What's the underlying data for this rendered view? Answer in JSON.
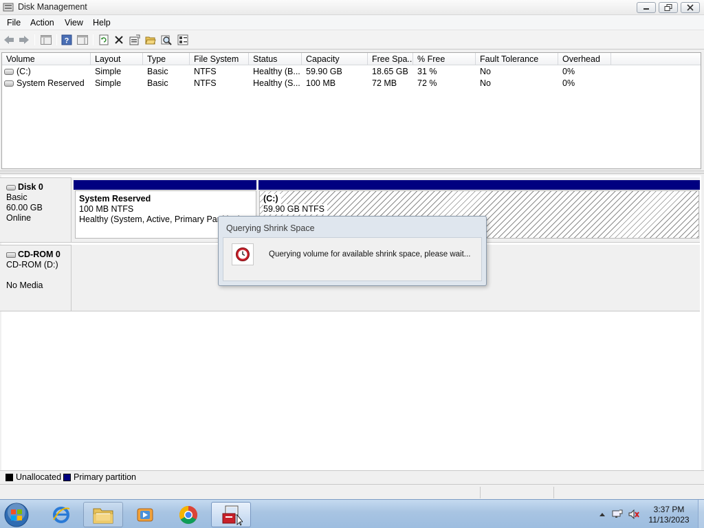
{
  "window": {
    "title": "Disk Management"
  },
  "menu": {
    "items": [
      "File",
      "Action",
      "View",
      "Help"
    ]
  },
  "volume_list": {
    "columns": [
      "Volume",
      "Layout",
      "Type",
      "File System",
      "Status",
      "Capacity",
      "Free Spa...",
      "% Free",
      "Fault Tolerance",
      "Overhead"
    ],
    "rows": [
      [
        "(C:)",
        "Simple",
        "Basic",
        "NTFS",
        "Healthy (B...",
        "59.90 GB",
        "18.65 GB",
        "31 %",
        "No",
        "0%"
      ],
      [
        "System Reserved",
        "Simple",
        "Basic",
        "NTFS",
        "Healthy (S...",
        "100 MB",
        "72 MB",
        "72 %",
        "No",
        "0%"
      ]
    ]
  },
  "disks": [
    {
      "name": "Disk 0",
      "kind": "Basic",
      "size": "60.00 GB",
      "status": "Online",
      "partitions": [
        {
          "name": "System Reserved",
          "detail": "100 MB NTFS",
          "status": "Healthy (System, Active, Primary Partition)"
        },
        {
          "name": "(C:)",
          "detail": "59.90 GB NTFS",
          "status": ""
        }
      ]
    },
    {
      "name": "CD-ROM 0",
      "kind": "CD-ROM (D:)",
      "size": "",
      "status": "No Media",
      "partitions": []
    }
  ],
  "legend": [
    {
      "label": "Unallocated",
      "color": "#000000"
    },
    {
      "label": "Primary partition",
      "color": "#000080"
    }
  ],
  "dialog": {
    "title": "Querying Shrink Space",
    "message": "Querying volume for available shrink space, please wait...",
    "icon": "clock-icon"
  },
  "taskbar": {
    "items": [
      "start-orb",
      "internet-explorer",
      "windows-explorer",
      "media-player",
      "chrome",
      "disk-management"
    ],
    "clock": {
      "time": "3:37 PM",
      "date": "11/13/2023"
    }
  },
  "colors": {
    "primary_partition": "#000080",
    "taskbar": "#a8c4e2"
  }
}
